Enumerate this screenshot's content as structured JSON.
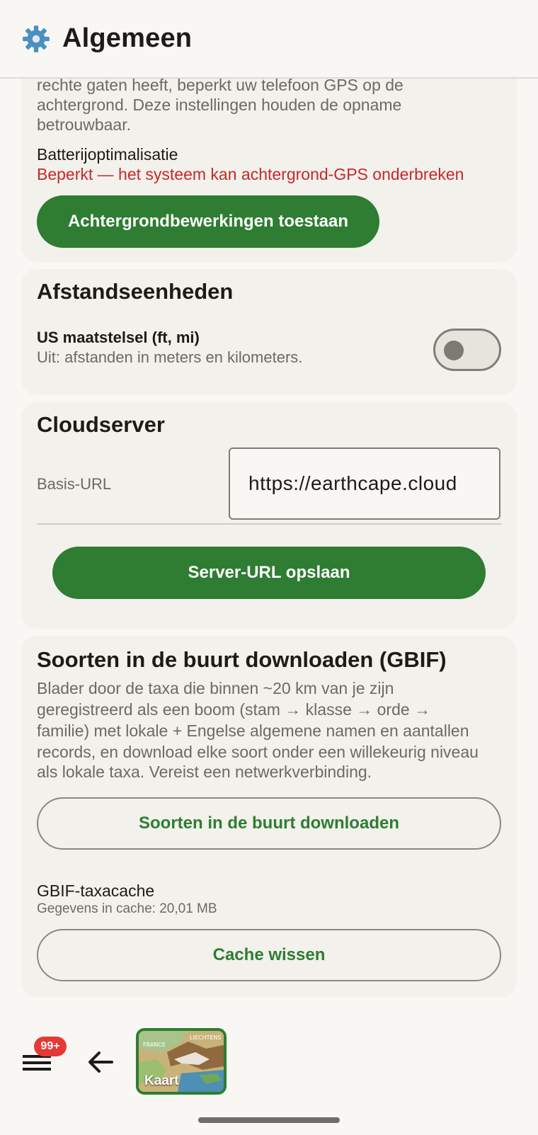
{
  "header": {
    "title": "Algemeen",
    "icon": "gear-icon"
  },
  "battery_card": {
    "intro_text_lines": [
      "rechte gaten heeft, beperkt uw telefoon GPS op de",
      "achtergrond. Deze instellingen houden de opname",
      "betrouwbaar."
    ],
    "label": "Batterijoptimalisatie",
    "status": "Beperkt — het systeem kan achtergrond-GPS onderbreken",
    "status_color": "#c62828",
    "button_label": "Achtergrondbewerkingen toestaan"
  },
  "units_card": {
    "title": "Afstandseenheden",
    "setting_label": "US maatstelsel (ft, mi)",
    "setting_desc": "Uit: afstanden in meters en kilometers.",
    "toggle_on": false
  },
  "cloud_card": {
    "title": "Cloudserver",
    "url_label": "Basis-URL",
    "url_value": "https://earthcape.cloud",
    "save_button": "Server-URL opslaan"
  },
  "gbif_card": {
    "title": "Soorten in de buurt downloaden (GBIF)",
    "desc_lines": [
      "Blader door de taxa die binnen ~20 km van je zijn",
      "geregistreerd als een boom (stam → klasse → orde →",
      "familie) met lokale + Engelse algemene namen en aantallen",
      "records, en download elke soort onder een willekeurig niveau",
      "als lokale taxa. Vereist een netwerkverbinding."
    ],
    "download_button": "Soorten in de buurt downloaden",
    "cache_label": "GBIF-taxacache",
    "cache_info": "Gegevens in cache: 20,01 MB",
    "clear_button": "Cache wissen"
  },
  "bottom_bar": {
    "badge": "99+",
    "map_label": "Kaart",
    "map_texts": [
      "FRANCE",
      "LIECHTENS"
    ]
  },
  "colors": {
    "accent": "#2e7d32",
    "background": "#f8f7f3",
    "card": "#f2f1ec",
    "badge": "#e53935"
  }
}
